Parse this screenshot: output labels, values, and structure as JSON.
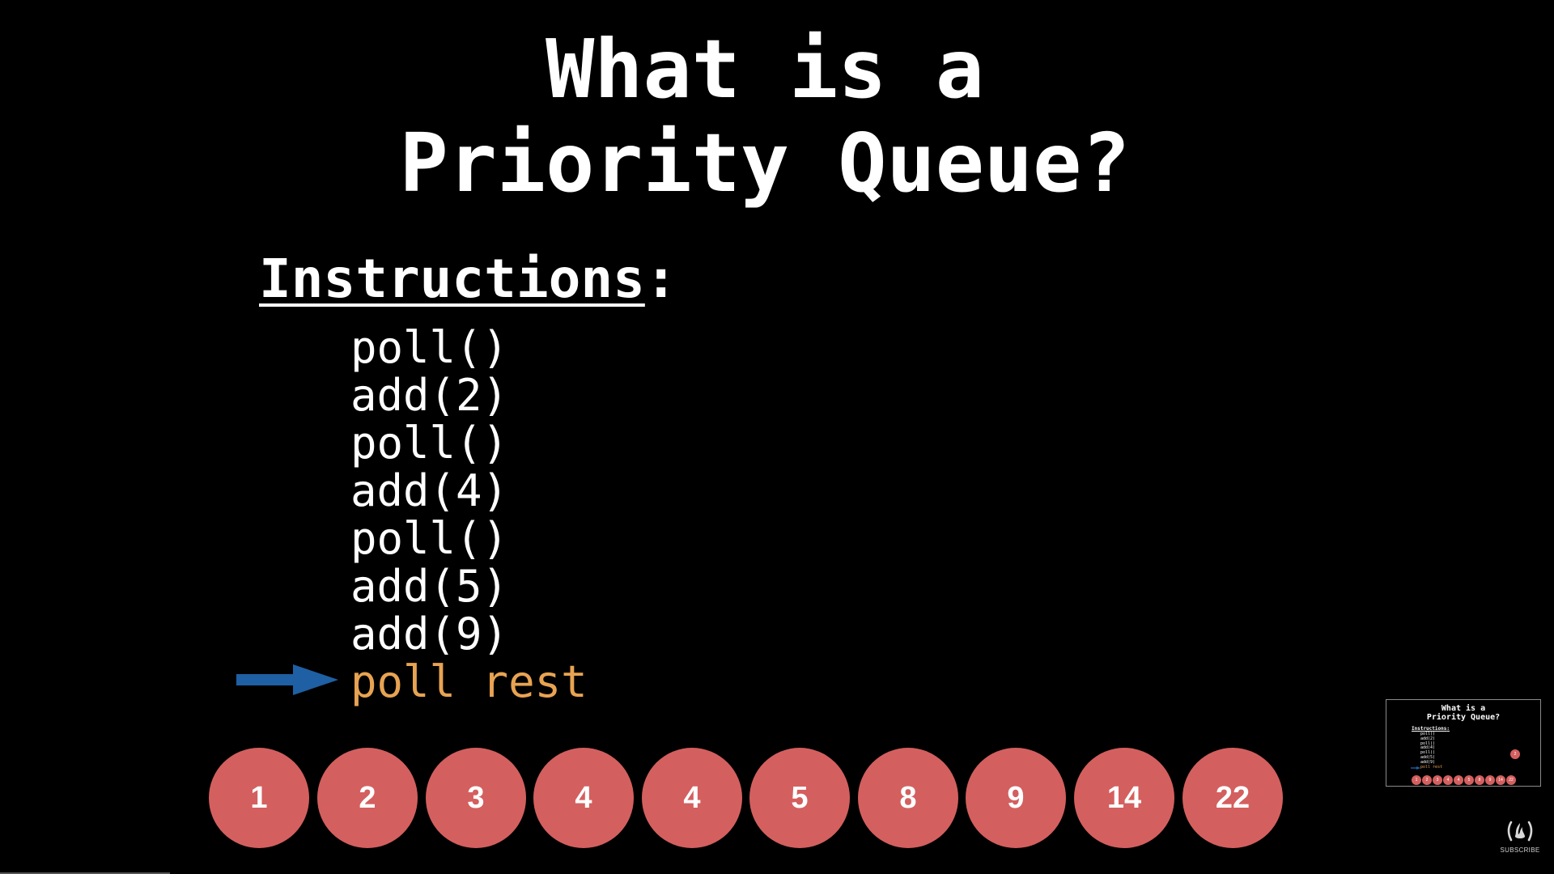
{
  "slide": {
    "title_lines": [
      "What is a",
      "Priority Queue?"
    ],
    "heading": "Instructions",
    "heading_suffix": ":",
    "instructions": [
      "poll()",
      "add(2)",
      "poll()",
      "add(4)",
      "poll()",
      "add(5)",
      "add(9)",
      "poll rest"
    ],
    "current_instruction_index": 7,
    "pointer_icon": "right-arrow-icon",
    "queue": [
      "1",
      "2",
      "3",
      "4",
      "4",
      "5",
      "8",
      "9",
      "14",
      "22"
    ]
  },
  "preview": {
    "float_node": "2"
  },
  "channel": {
    "logo_icon": "freecodecamp-logo-icon",
    "subscribe_label": "SUBSCRIBE"
  },
  "colors": {
    "background": "#000000",
    "text": "#ffffff",
    "highlight": "#e8a352",
    "arrow": "#1f5fa3",
    "node": "#d45f5f"
  }
}
